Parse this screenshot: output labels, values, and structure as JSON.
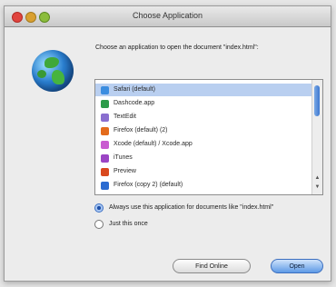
{
  "window": {
    "title": "Choose Application"
  },
  "dialog": {
    "prompt": "Choose an application to open the document \"index.html\":",
    "apps": [
      {
        "label": "Safari (default)",
        "icon": "safari-icon",
        "color": "#3b8de0",
        "selected": true
      },
      {
        "label": "Dashcode.app",
        "icon": "dashcode-icon",
        "color": "#2d9b4a",
        "selected": false
      },
      {
        "label": "TextEdit",
        "icon": "textedit-icon",
        "color": "#8a6fcf",
        "selected": false
      },
      {
        "label": "Firefox (default) (2)",
        "icon": "firefox-icon",
        "color": "#e36b1c",
        "selected": false
      },
      {
        "label": "Xcode (default) / Xcode.app",
        "icon": "xcode-icon",
        "color": "#c95bd0",
        "selected": false
      },
      {
        "label": "iTunes",
        "icon": "itunes-icon",
        "color": "#9b45c4",
        "selected": false
      },
      {
        "label": "Preview",
        "icon": "preview-icon",
        "color": "#d9491e",
        "selected": false
      },
      {
        "label": "Firefox (copy 2) (default)",
        "icon": "firefox-icon",
        "color": "#2b6bd1",
        "selected": false
      }
    ],
    "radio_always": "Always use this application for documents like \"index.html\"",
    "radio_once": "Just this once",
    "button_secondary": "Find Online",
    "button_primary": "Open"
  }
}
